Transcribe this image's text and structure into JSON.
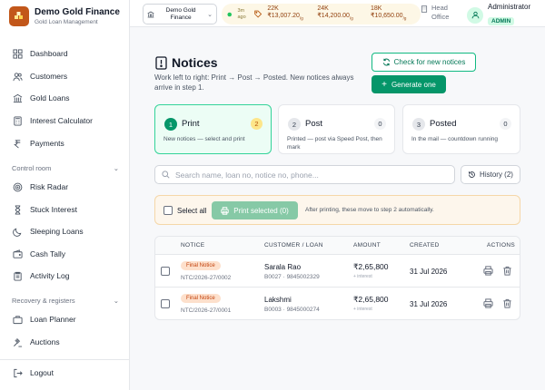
{
  "brand": {
    "title": "Demo Gold Finance",
    "subtitle": "Gold Loan Management"
  },
  "nav": {
    "dashboard": "Dashboard",
    "customers": "Customers",
    "gold_loans": "Gold Loans",
    "interest_calculator": "Interest Calculator",
    "payments": "Payments",
    "control_room": "Control room",
    "risk_radar": "Risk Radar",
    "stuck_interest": "Stuck Interest",
    "sleeping_loans": "Sleeping Loans",
    "cash_tally": "Cash Tally",
    "activity_log": "Activity Log",
    "recovery_registers": "Recovery & registers",
    "loan_planner": "Loan Planner",
    "auctions": "Auctions",
    "logout": "Logout"
  },
  "topbar": {
    "branch": "Demo Gold Finance",
    "rate_time": "3m ago",
    "rates": [
      {
        "karat": "22K",
        "price": "₹13,007.20",
        "unit": "/g"
      },
      {
        "karat": "24K",
        "price": "₹14,200.00",
        "unit": "/g"
      },
      {
        "karat": "18K",
        "price": "₹10,650.00",
        "unit": "/g"
      }
    ],
    "office": "Head Office",
    "user_name": "Administrator",
    "user_role": "ADMIN"
  },
  "page": {
    "title": "Notices",
    "subtitle": "Work left to right: Print → Post → Posted. New notices always arrive in step 1.",
    "check_button": "Check for new notices",
    "generate_button": "Generate one"
  },
  "steps": [
    {
      "num": "1",
      "title": "Print",
      "count": "2",
      "desc": "New notices — select and print"
    },
    {
      "num": "2",
      "title": "Post",
      "count": "0",
      "desc": "Printed — post via Speed Post, then mark"
    },
    {
      "num": "3",
      "title": "Posted",
      "count": "0",
      "desc": "In the mail — countdown running"
    }
  ],
  "search": {
    "placeholder": "Search name, loan no, notice no, phone..."
  },
  "history_button": "History (2)",
  "selection": {
    "select_all": "Select all",
    "print_button": "Print selected (0)",
    "note": "After printing, these move to step 2 automatically."
  },
  "table": {
    "headers": {
      "notice": "NOTICE",
      "customer": "CUSTOMER / LOAN",
      "amount": "AMOUNT",
      "created": "CREATED",
      "actions": "ACTIONS"
    },
    "rows": [
      {
        "type": "Final Notice",
        "code": "NTC/2026-27/0002",
        "name": "Sarala Rao",
        "meta": "B0027 · 9845002329",
        "amount": "₹2,65,800",
        "amount_sub": "+ interest",
        "created": "31 Jul 2026"
      },
      {
        "type": "Final Notice",
        "code": "NTC/2026-27/0001",
        "name": "Lakshmi",
        "meta": "B0003 · 9845000274",
        "amount": "₹2,65,800",
        "amount_sub": "+ interest",
        "created": "31 Jul 2026"
      }
    ]
  },
  "colors": {
    "accent": "#059669",
    "brand": "#c2571a",
    "warning_bg": "#fdf6ec",
    "badge": "#fde0cc"
  },
  "icons": {
    "dashboard": "grid-icon",
    "customers": "users-icon",
    "gold_loans": "bank-icon",
    "interest_calculator": "calculator-icon",
    "payments": "rupee-icon",
    "risk_radar": "radar-icon",
    "stuck_interest": "hourglass-icon",
    "sleeping_loans": "moon-icon",
    "cash_tally": "wallet-icon",
    "activity_log": "clipboard-icon",
    "loan_planner": "briefcase-icon",
    "auctions": "gavel-icon",
    "logout": "logout-icon"
  }
}
